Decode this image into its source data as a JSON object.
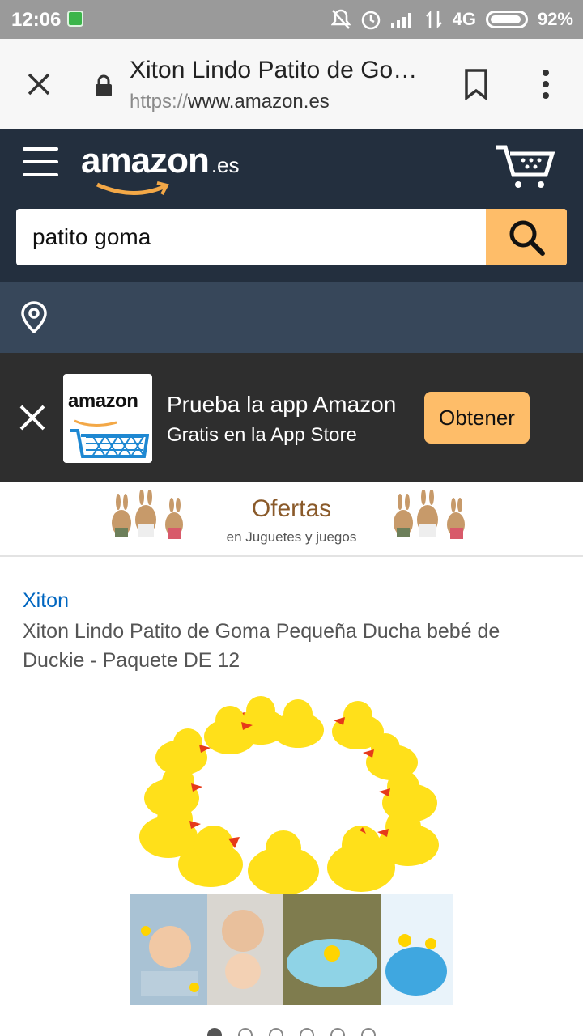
{
  "status_bar": {
    "time": "12:06",
    "network": "4G",
    "battery": "92%",
    "icons": [
      "app-notification-icon",
      "bell-off-icon",
      "alarm-icon",
      "signal-icon",
      "data-arrows-icon",
      "battery-icon"
    ]
  },
  "browser": {
    "page_title": "Xiton Lindo Patito de Goma Pequeña Ducha bebé de Duckie - Paquete DE 12",
    "url_scheme": "https://",
    "url_host": "www.amazon.es"
  },
  "header": {
    "logo_word": "amazon",
    "logo_tld": ".es",
    "search_value": "patito goma",
    "colors": {
      "nav_bg": "#232f3e",
      "search_button": "#febd69",
      "location_bg": "#37475a"
    }
  },
  "app_banner": {
    "logo_word": "amazon",
    "title": "Prueba la app Amazon",
    "subtitle": "Gratis en la App Store",
    "button": "Obtener"
  },
  "offers": {
    "title": "Ofertas",
    "subtitle": "en Juguetes y juegos"
  },
  "product": {
    "brand": "Xiton",
    "title": "Xiton Lindo Patito de Goma Pequeña Ducha bebé de Duckie - Paquete DE 12",
    "image_alt": "rubber ducks and baby bath photos",
    "carousel_dots": 6,
    "carousel_active_index": 0
  }
}
